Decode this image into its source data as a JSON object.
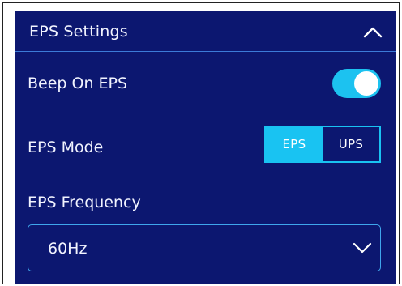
{
  "header": {
    "title": "EPS Settings"
  },
  "beep": {
    "label": "Beep On EPS",
    "enabled": true
  },
  "mode": {
    "label": "EPS Mode",
    "options": [
      "EPS",
      "UPS"
    ],
    "selected": "EPS"
  },
  "frequency": {
    "label": "EPS Frequency",
    "value": "60Hz"
  },
  "colors": {
    "panel_bg": "#0c1770",
    "accent": "#19c3f2",
    "divider": "#3c7bd8"
  },
  "icons": {
    "header_toggle": "chevron-up-icon",
    "select_toggle": "chevron-down-icon"
  }
}
